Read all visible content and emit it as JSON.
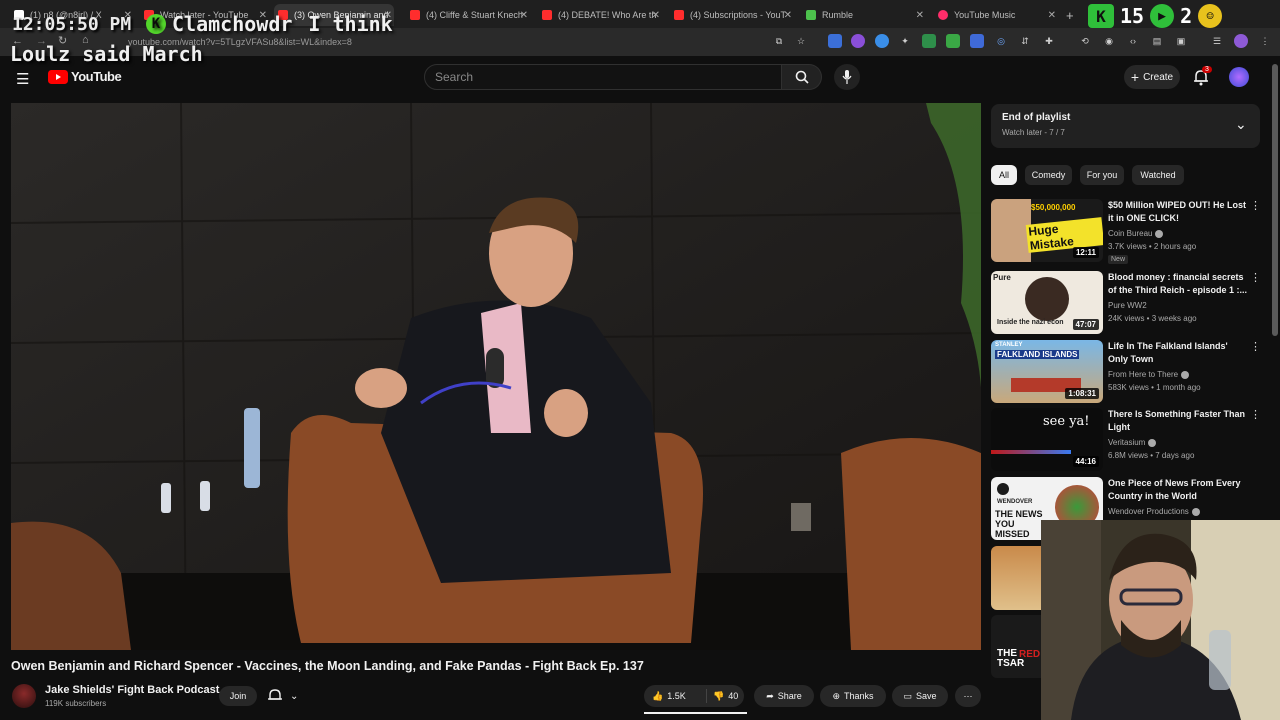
{
  "browser": {
    "tabs": [
      {
        "title": "(1) n8 (@n8irl) / X",
        "color": "#ffffff",
        "active": false
      },
      {
        "title": "Watch later - YouTube",
        "color": "#ff2d2d",
        "active": false
      },
      {
        "title": "(3) Owen Benjamin and",
        "color": "#ff2d2d",
        "active": true
      },
      {
        "title": "(4) Cliffe & Stuart Knech",
        "color": "#ff2d2d",
        "active": false
      },
      {
        "title": "(4) DEBATE! Who Are th",
        "color": "#ff2d2d",
        "active": false
      },
      {
        "title": "(4) Subscriptions - YouT",
        "color": "#ff2d2d",
        "active": false
      },
      {
        "title": "Rumble",
        "color": "#4cc14c",
        "active": false
      },
      {
        "title": "YouTube Music",
        "color": "#ff2d6a",
        "active": false
      }
    ],
    "url": "youtube.com/watch?v=5TLgzVFASu8&list=WL&index=8"
  },
  "overlay": {
    "clock": "12:05:50 PM",
    "chat_user": "Clamchowdr",
    "chat_text": "I think",
    "chat_line2": "Loulz said March",
    "counter_a": "15",
    "counter_b": "2"
  },
  "youtube": {
    "logo_text": "YouTube",
    "search_placeholder": "Search",
    "create_label": "Create",
    "notifications_count": "3"
  },
  "video": {
    "title": "Owen Benjamin and Richard Spencer - Vaccines, the Moon Landing, and Fake Pandas - Fight Back Ep. 137",
    "channel": "Jake Shields' Fight Back Podcast",
    "subscribers": "119K subscribers",
    "join_label": "Join",
    "likes": "1.5K",
    "dislikes": "40",
    "share_label": "Share",
    "thanks_label": "Thanks",
    "save_label": "Save"
  },
  "playlist": {
    "title": "End of playlist",
    "subtitle": "Watch later - 7 / 7"
  },
  "chips": [
    "All",
    "Comedy",
    "For you",
    "Watched"
  ],
  "recommendations": [
    {
      "title": "$50 Million WIPED OUT! He Lost it in ONE CLICK!",
      "channel": "Coin Bureau",
      "verified": true,
      "meta": "3.7K views • 2 hours ago",
      "duration": "12:11",
      "badge": "New",
      "thumb_text": "Huge Mistake",
      "thumb_top": "$50,000,000"
    },
    {
      "title": "Blood money : financial secrets of the Third Reich - episode 1 :...",
      "channel": "Pure WW2",
      "verified": false,
      "meta": "24K views • 3 weeks ago",
      "duration": "47:07",
      "badge": "",
      "thumb_text": "Inside the nazi econ",
      "thumb_top": "Pure"
    },
    {
      "title": "Life In The Falkland Islands' Only Town",
      "channel": "From Here to There",
      "verified": true,
      "meta": "583K views • 1 month ago",
      "duration": "1:08:31",
      "badge": "",
      "thumb_text": "FALKLAND ISLANDS",
      "thumb_top": "STANLEY"
    },
    {
      "title": "There Is Something Faster Than Light",
      "channel": "Veritasium",
      "verified": true,
      "meta": "6.8M views • 7 days ago",
      "duration": "44:16",
      "badge": "",
      "thumb_text": "see ya!",
      "thumb_top": ""
    },
    {
      "title": "One Piece of News From Every Country in the World",
      "channel": "Wendover Productions",
      "verified": true,
      "meta": "",
      "duration": "",
      "badge": "",
      "thumb_text": "THE NEWS YOU MISSED",
      "thumb_top": "WENDOVER"
    }
  ],
  "partial_thumbs": [
    {
      "text": "THE TSAR",
      "accent": "RED"
    }
  ],
  "colors": {
    "background": "#0f0f0f",
    "accent_red": "#ff0000",
    "chip_bg": "#272727"
  }
}
